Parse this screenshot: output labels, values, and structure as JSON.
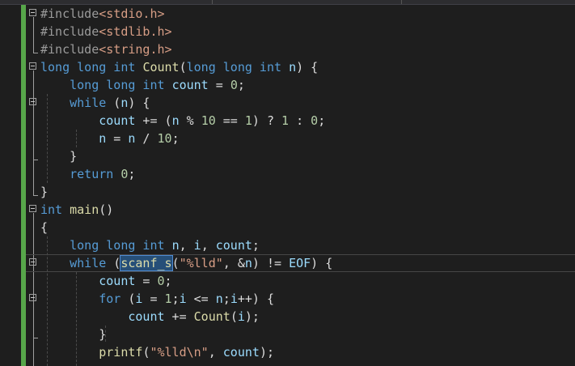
{
  "editor": {
    "lines": [
      [
        {
          "t": "#include",
          "c": "pp"
        },
        {
          "t": "<stdio.h>",
          "c": "str"
        }
      ],
      [
        {
          "t": "#include",
          "c": "pp"
        },
        {
          "t": "<stdlib.h>",
          "c": "str"
        }
      ],
      [
        {
          "t": "#include",
          "c": "pp"
        },
        {
          "t": "<string.h>",
          "c": "str"
        }
      ],
      [
        {
          "t": "long long int ",
          "c": "kw"
        },
        {
          "t": "Count",
          "c": "fn"
        },
        {
          "t": "(",
          "c": "tx"
        },
        {
          "t": "long long int ",
          "c": "kw"
        },
        {
          "t": "n",
          "c": "var"
        },
        {
          "t": ") {",
          "c": "tx"
        }
      ],
      [
        {
          "t": "    long long int ",
          "c": "kw"
        },
        {
          "t": "count",
          "c": "var"
        },
        {
          "t": " = ",
          "c": "tx"
        },
        {
          "t": "0",
          "c": "num"
        },
        {
          "t": ";",
          "c": "tx"
        }
      ],
      [
        {
          "t": "    while",
          "c": "kw"
        },
        {
          "t": " (",
          "c": "tx"
        },
        {
          "t": "n",
          "c": "var"
        },
        {
          "t": ") {",
          "c": "tx"
        }
      ],
      [
        {
          "t": "        count",
          "c": "var"
        },
        {
          "t": " += (",
          "c": "tx"
        },
        {
          "t": "n",
          "c": "var"
        },
        {
          "t": " % ",
          "c": "tx"
        },
        {
          "t": "10",
          "c": "num"
        },
        {
          "t": " == ",
          "c": "tx"
        },
        {
          "t": "1",
          "c": "num"
        },
        {
          "t": ") ? ",
          "c": "tx"
        },
        {
          "t": "1",
          "c": "num"
        },
        {
          "t": " : ",
          "c": "tx"
        },
        {
          "t": "0",
          "c": "num"
        },
        {
          "t": ";",
          "c": "tx"
        }
      ],
      [
        {
          "t": "        n",
          "c": "var"
        },
        {
          "t": " = ",
          "c": "tx"
        },
        {
          "t": "n",
          "c": "var"
        },
        {
          "t": " / ",
          "c": "tx"
        },
        {
          "t": "10",
          "c": "num"
        },
        {
          "t": ";",
          "c": "tx"
        }
      ],
      [
        {
          "t": "    }",
          "c": "tx"
        }
      ],
      [
        {
          "t": "    return ",
          "c": "kw"
        },
        {
          "t": "0",
          "c": "num"
        },
        {
          "t": ";",
          "c": "tx"
        }
      ],
      [
        {
          "t": "}",
          "c": "tx"
        }
      ],
      [
        {
          "t": "int ",
          "c": "kw"
        },
        {
          "t": "main",
          "c": "fn"
        },
        {
          "t": "()",
          "c": "tx"
        }
      ],
      [
        {
          "t": "{",
          "c": "tx"
        }
      ],
      [
        {
          "t": "    long long int ",
          "c": "kw"
        },
        {
          "t": "n",
          "c": "var"
        },
        {
          "t": ", ",
          "c": "tx"
        },
        {
          "t": "i",
          "c": "var"
        },
        {
          "t": ", ",
          "c": "tx"
        },
        {
          "t": "count",
          "c": "var"
        },
        {
          "t": ";",
          "c": "tx"
        }
      ],
      [
        {
          "t": "    while",
          "c": "kw"
        },
        {
          "t": " (",
          "c": "tx"
        },
        {
          "t": "scanf_s",
          "c": "fn",
          "sel": true
        },
        {
          "t": "(",
          "c": "tx"
        },
        {
          "t": "\"%lld\"",
          "c": "str"
        },
        {
          "t": ", &",
          "c": "tx"
        },
        {
          "t": "n",
          "c": "var"
        },
        {
          "t": ") != ",
          "c": "tx"
        },
        {
          "t": "EOF",
          "c": "var"
        },
        {
          "t": ") {",
          "c": "tx"
        }
      ],
      [
        {
          "t": "        count",
          "c": "var"
        },
        {
          "t": " = ",
          "c": "tx"
        },
        {
          "t": "0",
          "c": "num"
        },
        {
          "t": ";",
          "c": "tx"
        }
      ],
      [
        {
          "t": "        for",
          "c": "kw"
        },
        {
          "t": " (",
          "c": "tx"
        },
        {
          "t": "i",
          "c": "var"
        },
        {
          "t": " = ",
          "c": "tx"
        },
        {
          "t": "1",
          "c": "num"
        },
        {
          "t": ";",
          "c": "tx"
        },
        {
          "t": "i",
          "c": "var"
        },
        {
          "t": " <= ",
          "c": "tx"
        },
        {
          "t": "n",
          "c": "var"
        },
        {
          "t": ";",
          "c": "tx"
        },
        {
          "t": "i",
          "c": "var"
        },
        {
          "t": "++) {",
          "c": "tx"
        }
      ],
      [
        {
          "t": "            count",
          "c": "var"
        },
        {
          "t": " += ",
          "c": "tx"
        },
        {
          "t": "Count",
          "c": "fn"
        },
        {
          "t": "(",
          "c": "tx"
        },
        {
          "t": "i",
          "c": "var"
        },
        {
          "t": ");",
          "c": "tx"
        }
      ],
      [
        {
          "t": "        }",
          "c": "tx"
        }
      ],
      [
        {
          "t": "        printf",
          "c": "fn"
        },
        {
          "t": "(",
          "c": "tx"
        },
        {
          "t": "\"%lld\\n\"",
          "c": "str"
        },
        {
          "t": ", ",
          "c": "tx"
        },
        {
          "t": "count",
          "c": "var"
        },
        {
          "t": ");",
          "c": "tx"
        }
      ]
    ],
    "fold_lines": [
      0,
      3,
      5,
      11,
      14,
      16
    ],
    "caret_line": 14,
    "colors": {
      "background": "#1e1e1e",
      "keyword": "#569cd6",
      "preprocessor": "#9b9b9b",
      "string": "#d69d85",
      "number": "#b5cea8",
      "function": "#dcdcaa",
      "variable": "#9cdcfe",
      "text": "#dcdcdc",
      "change_bar": "#57a64a",
      "selection": "#264f78"
    }
  }
}
